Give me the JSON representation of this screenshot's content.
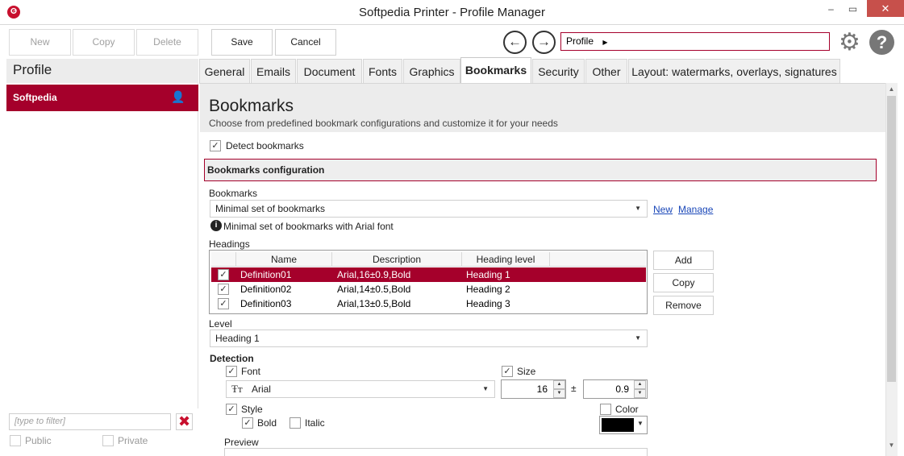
{
  "window": {
    "title": "Softpedia Printer - Profile Manager",
    "app_icon_glyph": "❻",
    "minimize_glyph": "‒",
    "maximize_glyph": "▭",
    "close_glyph": "✕"
  },
  "toolbar": {
    "new_label": "New",
    "copy_label": "Copy",
    "delete_label": "Delete",
    "save_label": "Save",
    "cancel_label": "Cancel",
    "back_glyph": "←",
    "forward_glyph": "→",
    "breadcrumb_value": "Profile",
    "breadcrumb_arrow": "▶",
    "settings_glyph": "⚙",
    "help_glyph": "?"
  },
  "sidebar": {
    "title": "Profile",
    "items": [
      {
        "label": "Softpedia",
        "icon": "user-icon",
        "icon_glyph": "👤",
        "selected": true
      }
    ],
    "filter_placeholder": "[type to filter]",
    "clear_glyph": "✖",
    "public_label": "Public",
    "private_label": "Private"
  },
  "tabs": [
    {
      "label": "General"
    },
    {
      "label": "Emails"
    },
    {
      "label": "Document"
    },
    {
      "label": "Fonts"
    },
    {
      "label": "Graphics"
    },
    {
      "label": "Bookmarks",
      "active": true
    },
    {
      "label": "Security"
    },
    {
      "label": "Other"
    },
    {
      "label": "Layout: watermarks, overlays, signatures"
    }
  ],
  "page": {
    "title": "Bookmarks",
    "subtitle": "Choose from predefined bookmark configurations and customize it for your needs",
    "detect_label": "Detect bookmarks",
    "detect_checked": true,
    "section_title": "Bookmarks configuration",
    "bookmarks_label": "Bookmarks",
    "bookmarks_value": "Minimal set of bookmarks",
    "new_link": "New",
    "manage_link": "Manage",
    "info_glyph": "i",
    "info_text": "Minimal set of bookmarks with Arial font",
    "headings_label": "Headings",
    "check_glyph": "✓",
    "dropdown_glyph": "▼",
    "spin_up_glyph": "▲",
    "spin_down_glyph": "▼",
    "font_icon_glyph": "Ŧт",
    "headings_columns": [
      "Name",
      "Description",
      "Heading level"
    ],
    "headings_rows": [
      {
        "checked": true,
        "name": "Definition01",
        "description": "Arial,16±0.9,Bold",
        "level": "Heading 1",
        "selected": true
      },
      {
        "checked": true,
        "name": "Definition02",
        "description": "Arial,14±0.5,Bold",
        "level": "Heading 2",
        "selected": false
      },
      {
        "checked": true,
        "name": "Definition03",
        "description": "Arial,13±0.5,Bold",
        "level": "Heading 3",
        "selected": false
      }
    ],
    "add_label": "Add",
    "copy_label": "Copy",
    "remove_label": "Remove",
    "level_label": "Level",
    "level_value": "Heading 1",
    "detection_label": "Detection",
    "font_label": "Font",
    "font_checked": true,
    "font_value": "Arial",
    "size_label": "Size",
    "size_checked": true,
    "size_value": "16",
    "plusminus": "±",
    "tolerance_value": "0.9",
    "style_label": "Style",
    "style_checked": true,
    "bold_label": "Bold",
    "bold_checked": true,
    "italic_label": "Italic",
    "italic_checked": false,
    "color_label": "Color",
    "color_checked": false,
    "color_value": "#000000",
    "preview_label": "Preview"
  },
  "colors": {
    "accent": "#a5002b",
    "close_button": "#c7504b"
  }
}
